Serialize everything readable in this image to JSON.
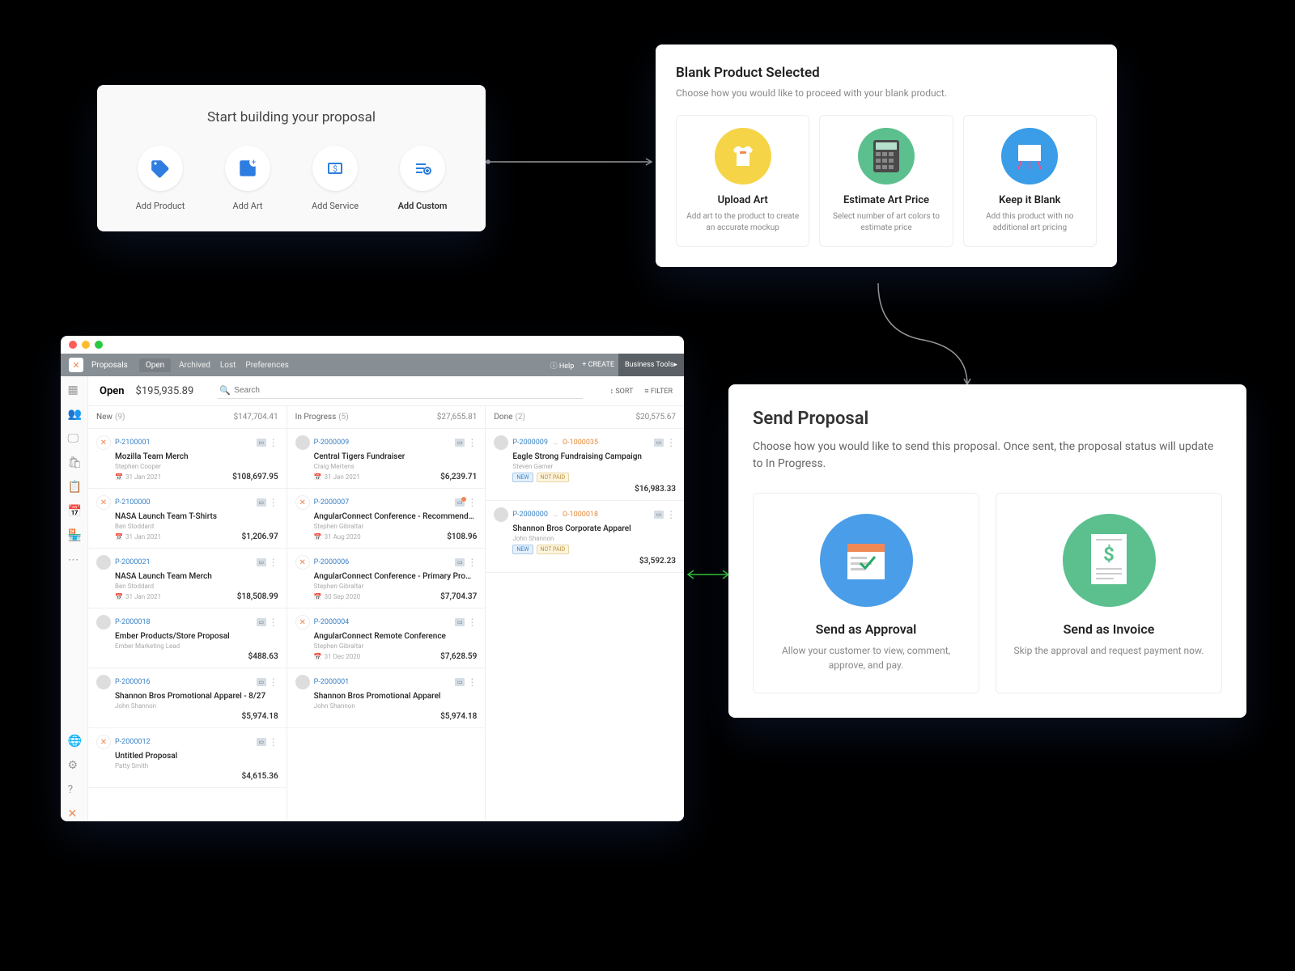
{
  "panel1": {
    "title": "Start building your proposal",
    "items": [
      {
        "label": "Add Product"
      },
      {
        "label": "Add Art"
      },
      {
        "label": "Add Service"
      },
      {
        "label": "Add Custom"
      }
    ]
  },
  "panel2": {
    "title": "Blank Product Selected",
    "subtitle": "Choose how you would like to proceed with your blank product.",
    "options": [
      {
        "title": "Upload Art",
        "desc": "Add art to the product to create an accurate mockup"
      },
      {
        "title": "Estimate Art Price",
        "desc": "Select number of art colors to estimate price"
      },
      {
        "title": "Keep it Blank",
        "desc": "Add this product with no additional art pricing"
      }
    ]
  },
  "panel3": {
    "title": "Send Proposal",
    "subtitle": "Choose how you would like to send this proposal. Once sent, the proposal status will update to In Progress.",
    "options": [
      {
        "title": "Send as Approval",
        "desc": "Allow your customer to view, comment, approve, and pay."
      },
      {
        "title": "Send as Invoice",
        "desc": "Skip the approval and request payment now."
      }
    ]
  },
  "app": {
    "section": "Proposals",
    "tabs": [
      "Open",
      "Archived",
      "Lost",
      "Preferences"
    ],
    "topRight": {
      "help": "Help",
      "create": "CREATE",
      "tools": "Business Tools"
    },
    "header": {
      "title": "Open",
      "amount": "$195,935.89",
      "searchPlaceholder": "Search",
      "sort": "SORT",
      "filter": "FILTER"
    },
    "columns": [
      {
        "name": "New",
        "count": "(9)",
        "total": "$147,704.41",
        "cards": [
          {
            "id": "P-2100001",
            "title": "Mozilla Team Merch",
            "sub": "Stephen Cooper",
            "date": "31 Jan 2021",
            "amt": "$108,697.95",
            "logo": true
          },
          {
            "id": "P-2100000",
            "title": "NASA Launch Team T-Shirts",
            "sub": "Ben Stoddard",
            "date": "31 Jan 2021",
            "amt": "$1,206.97",
            "logo": true
          },
          {
            "id": "P-2000021",
            "title": "NASA Launch Team Merch",
            "sub": "Ben Stoddard",
            "date": "31 Jan 2021",
            "amt": "$18,508.99"
          },
          {
            "id": "P-2000018",
            "title": "Ember Products/Store Proposal",
            "sub": "Ember Marketing Lead",
            "amt": "$488.63"
          },
          {
            "id": "P-2000016",
            "title": "Shannon Bros Promotional Apparel - 8/27",
            "sub": "John Shannon",
            "amt": "$5,974.18"
          },
          {
            "id": "P-2000012",
            "title": "Untitled Proposal",
            "sub": "Patty Smith",
            "amt": "$4,615.36",
            "logo": true
          }
        ]
      },
      {
        "name": "In Progress",
        "count": "(5)",
        "total": "$27,655.81",
        "cards": [
          {
            "id": "P-2000009",
            "title": "Central Tigers Fundraiser",
            "sub": "Craig Mertens",
            "date": "31 Jan 2021",
            "amt": "$6,239.71"
          },
          {
            "id": "P-2000007",
            "title": "AngularConnect Conference - Recommend…",
            "sub": "Stephen Gibraltar",
            "date": "31 Aug 2020",
            "amt": "$108.96",
            "logo": true,
            "badge": true
          },
          {
            "id": "P-2000006",
            "title": "AngularConnect Conference - Primary Pro…",
            "sub": "Stephen Gibraltar",
            "date": "30 Sep 2020",
            "amt": "$7,704.37",
            "logo": true
          },
          {
            "id": "P-2000004",
            "title": "AngularConnect Remote Conference",
            "sub": "Stephen Gibraltar",
            "date": "31 Dec 2020",
            "amt": "$7,628.59",
            "logo": true
          },
          {
            "id": "P-2000001",
            "title": "Shannon Bros Promotional Apparel",
            "sub": "John Shannon",
            "amt": "$5,974.18"
          }
        ]
      },
      {
        "name": "Done",
        "count": "(2)",
        "total": "$20,575.67",
        "cards": [
          {
            "id": "P-2000009",
            "id2": "O-1000035",
            "title": "Eagle Strong Fundraising Campaign",
            "sub": "Steven Garner",
            "amt": "$16,983.33",
            "tags": true
          },
          {
            "id": "P-2000000",
            "id2": "O-1000018",
            "title": "Shannon Bros Corporate Apparel",
            "sub": "John Shannon",
            "amt": "$3,592.23",
            "tags": true
          }
        ]
      }
    ],
    "tagNew": "NEW",
    "tagNotPaid": "NOT PAID"
  }
}
